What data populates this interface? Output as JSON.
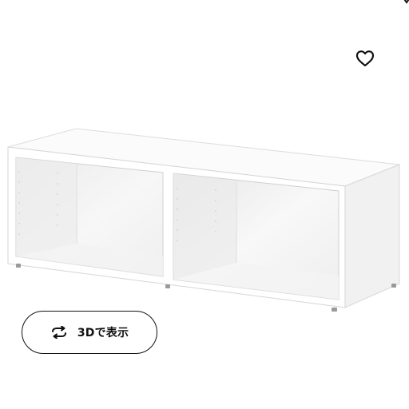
{
  "product": {
    "image_icon": "product-photo-white-open-shelf-unit"
  },
  "actions": {
    "favorite_icon": "heart-icon",
    "view_3d_icon": "rotate-arrows-icon",
    "view_3d_label": "3Dで表示"
  },
  "colors": {
    "background": "#ffffff",
    "text": "#111111",
    "border": "#111111"
  }
}
